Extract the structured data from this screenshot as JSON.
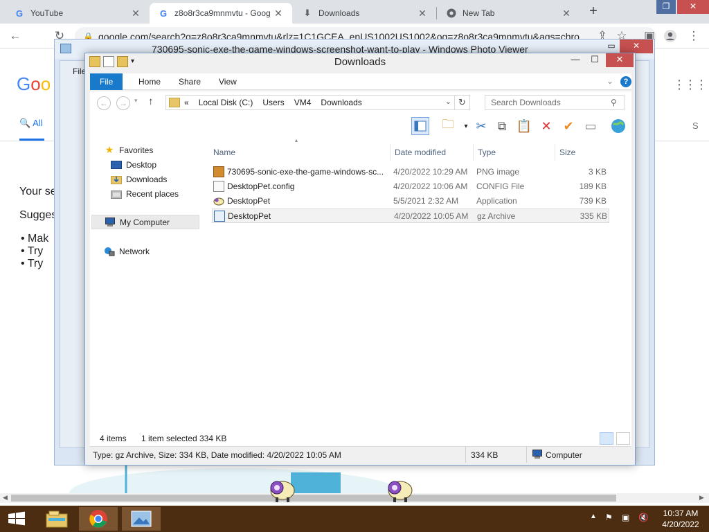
{
  "browser": {
    "tabs": [
      {
        "label": "YouTube",
        "icon": "google-icon",
        "active": false
      },
      {
        "label": "z8o8r3ca9mnmvtu - Goog",
        "icon": "google-icon",
        "active": true
      },
      {
        "label": "Downloads",
        "icon": "download-icon",
        "active": false
      },
      {
        "label": "New Tab",
        "icon": "chrome-icon",
        "active": false
      }
    ],
    "new_tab_label": "+",
    "url": "google.com/search?q=z8o8r3ca9mnmvtu&rlz=1C1GCEA_enUS1002US1002&oq=z8o8r3ca9mnmvtu&aqs=chro",
    "page": {
      "logo": "Goo",
      "tab_all": "All",
      "text_your_search": "Your se",
      "text_suggestions": "Sugges",
      "bullets": [
        "Mak",
        "Try",
        "Try"
      ],
      "right_fragment": "S"
    }
  },
  "photo_viewer": {
    "title": "730695-sonic-exe-the-game-windows-screenshot-want-to-play - Windows Photo Viewer",
    "menu_file": "File"
  },
  "explorer": {
    "title": "Downloads",
    "ribbon_tabs": [
      "File",
      "Home",
      "Share",
      "View"
    ],
    "address": {
      "prefix": "«",
      "crumbs": [
        "Local Disk (C:)",
        "Users",
        "VM4",
        "Downloads"
      ]
    },
    "search_placeholder": "Search Downloads",
    "nav": {
      "favorites": "Favorites",
      "desktop": "Desktop",
      "downloads": "Downloads",
      "recent": "Recent places",
      "mycomputer": "My Computer",
      "network": "Network"
    },
    "columns": {
      "name": "Name",
      "date": "Date modified",
      "type": "Type",
      "size": "Size"
    },
    "files": [
      {
        "name": "730695-sonic-exe-the-game-windows-sc...",
        "date": "4/20/2022 10:29 AM",
        "type": "PNG image",
        "size": "3 KB",
        "icon": "image-file-icon"
      },
      {
        "name": "DesktopPet.config",
        "date": "4/20/2022 10:06 AM",
        "type": "CONFIG File",
        "size": "189 KB",
        "icon": "config-file-icon"
      },
      {
        "name": "DesktopPet",
        "date": "5/5/2021 2:32 AM",
        "type": "Application",
        "size": "739 KB",
        "icon": "sheep-app-icon"
      },
      {
        "name": "DesktopPet",
        "date": "4/20/2022 10:05 AM",
        "type": "gz Archive",
        "size": "335 KB",
        "icon": "archive-file-icon",
        "selected": true
      }
    ],
    "status": {
      "items": "4 items",
      "selected": "1 item selected",
      "selected_size": "334 KB"
    },
    "details": {
      "info": "Type: gz Archive, Size: 334 KB, Date modified: 4/20/2022 10:05 AM",
      "size": "334 KB",
      "location": "Computer"
    }
  },
  "taskbar": {
    "time": "10:37 AM",
    "date": "4/20/2022"
  },
  "colors": {
    "taskbar": "#4d2d11",
    "accent": "#1979ca",
    "close_red": "#c75050"
  }
}
